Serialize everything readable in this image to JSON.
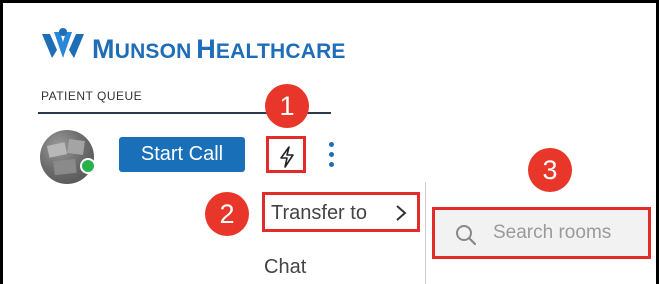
{
  "brand": {
    "logo_initial_m": "M",
    "logo_word_1": "UNSON",
    "logo_initial_h": "H",
    "logo_word_2": "EALTHCARE",
    "color": "#1f6db6"
  },
  "queue": {
    "section_label": "PATIENT QUEUE",
    "patient": {
      "avatar_icon": "patient-avatar",
      "status": "online",
      "status_color": "#2bb14b"
    },
    "start_call_label": "Start Call",
    "quick_action_icon": "lightning-bolt-icon",
    "more_icon": "vertical-ellipsis-icon"
  },
  "dropdown": {
    "items": [
      {
        "label": "Transfer to",
        "icon": "chevron-right-icon"
      },
      {
        "label": "Chat"
      }
    ]
  },
  "search": {
    "placeholder": "Search rooms",
    "icon": "search-icon"
  },
  "callouts": [
    {
      "number": "1",
      "color": "#e9362a"
    },
    {
      "number": "2",
      "color": "#e9362a"
    },
    {
      "number": "3",
      "color": "#e9362a"
    }
  ]
}
